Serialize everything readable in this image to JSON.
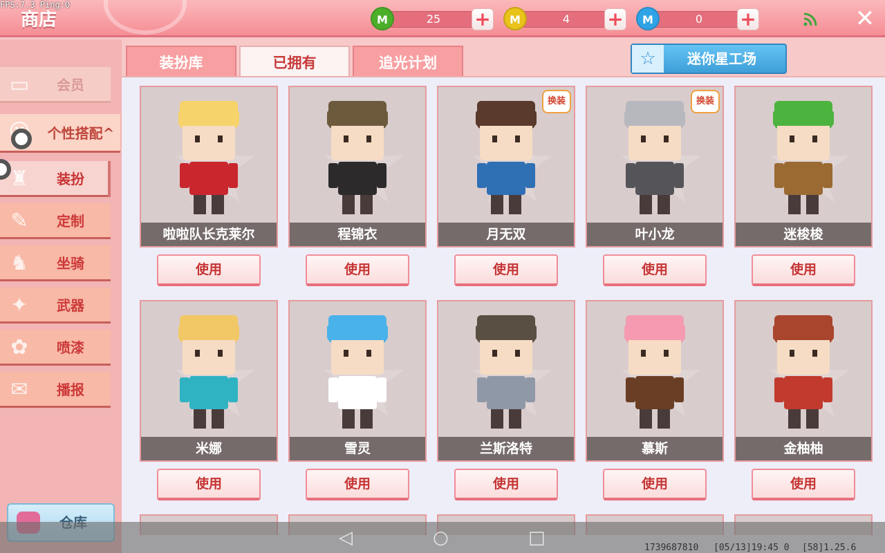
{
  "status": {
    "fps": "FPS:7.3 Ping:0"
  },
  "header": {
    "title": "商店",
    "currencies": [
      {
        "name": "green-gem",
        "value": "25",
        "color": "#4caf2a",
        "glyph": "M"
      },
      {
        "name": "gold-coin",
        "value": "4",
        "color": "#e9c21a",
        "glyph": "M"
      },
      {
        "name": "blue-coin",
        "value": "0",
        "color": "#2fa3e6",
        "glyph": "M"
      }
    ],
    "plus_label": "+",
    "close_label": "✕"
  },
  "sidebar": {
    "member_label": "会员",
    "section_label": "个性搭配",
    "section_chevron": "^",
    "items": [
      {
        "label": "装扮",
        "glyph": "♜"
      },
      {
        "label": "定制",
        "glyph": "✎"
      },
      {
        "label": "坐骑",
        "glyph": "♞"
      },
      {
        "label": "武器",
        "glyph": "✦"
      },
      {
        "label": "喷漆",
        "glyph": "✿"
      },
      {
        "label": "播报",
        "glyph": "✉"
      }
    ],
    "warehouse_label": "仓库"
  },
  "tabs": [
    {
      "label": "装扮库"
    },
    {
      "label": "已拥有"
    },
    {
      "label": "追光计划"
    }
  ],
  "mini_workshop_label": "迷你星工场",
  "use_label": "使用",
  "tag_label": "换装",
  "cards": [
    {
      "name": "啦啦队长克莱尔",
      "hair": "#f6d36b",
      "body": "#c9262d",
      "tag": false
    },
    {
      "name": "程锦衣",
      "hair": "#6d5a3d",
      "body": "#2c2a2a",
      "tag": false
    },
    {
      "name": "月无双",
      "hair": "#5a3a2c",
      "body": "#2f6fb4",
      "tag": true
    },
    {
      "name": "叶小龙",
      "hair": "#b7b7be",
      "body": "#555459",
      "tag": true
    },
    {
      "name": "迷梭梭",
      "hair": "#4cb33f",
      "body": "#9a6a32",
      "tag": false
    },
    {
      "name": "米娜",
      "hair": "#f2c766",
      "body": "#2fb3c3",
      "tag": false
    },
    {
      "name": "雪灵",
      "hair": "#4ab2ea",
      "body": "#ffffff",
      "tag": false
    },
    {
      "name": "兰斯洛特",
      "hair": "#5a4f43",
      "body": "#8f98a6",
      "tag": false
    },
    {
      "name": "慕斯",
      "hair": "#f59ab0",
      "body": "#6a3e25",
      "tag": false
    },
    {
      "name": "金柚柚",
      "hair": "#a9452c",
      "body": "#c13a2d",
      "tag": false
    }
  ],
  "navbar": {
    "back_glyph": "◁",
    "home_glyph": "○",
    "recent_glyph": "□",
    "info_id": "1739687810",
    "info_time": "[05/13]19:45 0",
    "info_ver": "[58]1.25.6"
  }
}
